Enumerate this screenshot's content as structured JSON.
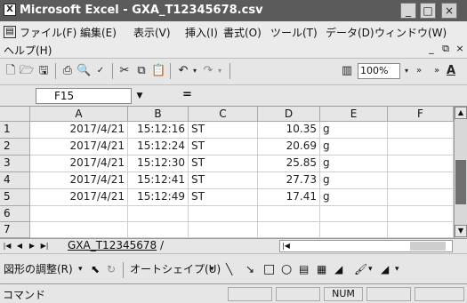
{
  "window": {
    "title": "Microsoft Excel - GXA_T12345678.csv",
    "icon": "excel-app-icon",
    "controls": [
      "_",
      "□",
      "×"
    ]
  },
  "menu": {
    "items": [
      "ファイル(F)",
      "編集(E)",
      "表示(V)",
      "挿入(I)",
      "書式(O)",
      "ツール(T)",
      "データ(D)",
      "ウィンドウ(W)"
    ],
    "help": "ヘルプ(H)",
    "mdi": [
      "_",
      "⧉",
      "×"
    ]
  },
  "toolbar": {
    "zoom": "100%",
    "icons": [
      "new-doc-icon",
      "open-folder-icon",
      "save-disk-icon",
      "print-icon",
      "print-preview-icon",
      "spellcheck-icon",
      "cut-icon",
      "copy-icon",
      "paste-icon",
      "undo-icon",
      "redo-icon",
      "chart-wizard-icon",
      "font-color-icon"
    ]
  },
  "formula_bar": {
    "name_box": "F15",
    "eq": "="
  },
  "grid": {
    "columns": [
      "A",
      "B",
      "C",
      "D",
      "E",
      "F"
    ],
    "rows": [
      {
        "n": "1",
        "a": "2017/4/21",
        "b": "15:12:16",
        "c": "ST",
        "d": "10.35",
        "e": "g"
      },
      {
        "n": "2",
        "a": "2017/4/21",
        "b": "15:12:24",
        "c": "ST",
        "d": "20.69",
        "e": "g"
      },
      {
        "n": "3",
        "a": "2017/4/21",
        "b": "15:12:30",
        "c": "ST",
        "d": "25.85",
        "e": "g"
      },
      {
        "n": "4",
        "a": "2017/4/21",
        "b": "15:12:41",
        "c": "ST",
        "d": "27.73",
        "e": "g"
      },
      {
        "n": "5",
        "a": "2017/4/21",
        "b": "15:12:49",
        "c": "ST",
        "d": "17.41",
        "e": "g"
      },
      {
        "n": "6",
        "a": "",
        "b": "",
        "c": "",
        "d": "",
        "e": ""
      },
      {
        "n": "7",
        "a": "",
        "b": "",
        "c": "",
        "d": "",
        "e": ""
      }
    ]
  },
  "sheet_tab": "GXA_T12345678",
  "drawbar": {
    "figure_adjust": "図形の調整(R)",
    "autoshape": "オートシェイプ(U)"
  },
  "status": {
    "text": "コマンド",
    "num": "NUM"
  }
}
